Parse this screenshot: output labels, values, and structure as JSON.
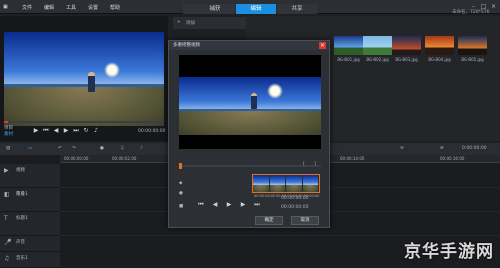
{
  "menu": {
    "items": [
      "文件",
      "编辑",
      "工具",
      "设置",
      "帮助"
    ],
    "tabs": [
      {
        "label": "捕获"
      },
      {
        "label": "编辑"
      },
      {
        "label": "共享"
      }
    ],
    "status": "未命名，720*576"
  },
  "preview": {
    "mode_project": "项目",
    "mode_clip": "素材",
    "timecode": "00:00:00:00",
    "timecode_small": "00:00:00"
  },
  "library": {
    "add_label": "添加",
    "search_placeholder": "搜索当前视图",
    "thumbs": [
      {
        "label": "BG-B01.jpg"
      },
      {
        "label": "BG-B02.jpg"
      },
      {
        "label": "BG-B03.jpg"
      },
      {
        "label": "BG-B04.jpg"
      },
      {
        "label": "BG-B05.jpg"
      }
    ]
  },
  "timeline": {
    "ruler": [
      "00:00:00:00",
      "00:00:02:00",
      "00:00:04:00",
      "00:00:14:00",
      "00:00:16:00"
    ],
    "tracks": [
      {
        "name": "视频",
        "icon": "video-track-icon"
      },
      {
        "name": "覆叠1",
        "icon": "overlay-track-icon"
      },
      {
        "name": "标题1",
        "icon": "title-track-icon"
      },
      {
        "name": "声音",
        "icon": "voice-track-icon"
      },
      {
        "name": "音乐1",
        "icon": "music-track-icon"
      }
    ],
    "timecode_right": "0:00:00:00"
  },
  "dialog": {
    "title": "多重修整视频",
    "ok_label": "确定",
    "cancel_label": "取消",
    "timecode": "00:00:00:00",
    "timecode2": "00:00:00:00",
    "speed_label": "1x",
    "film_labels": [
      "00:00:00:00",
      "00:00:00:00",
      "00:00:00:00"
    ]
  },
  "watermark": "京华手游网",
  "colors": {
    "accent": "#1b8fe0",
    "trim_marker": "#e2731e",
    "playhead": "#e23b3b"
  }
}
